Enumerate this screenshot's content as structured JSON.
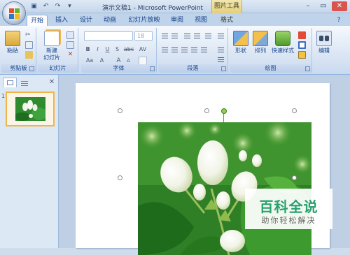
{
  "window": {
    "title": "演示文稿1 - Microsoft PowerPoint",
    "contextual_tools_label": "图片工具",
    "controls": [
      "minimize-icon",
      "maximize-icon",
      "close-icon"
    ]
  },
  "quick_access": [
    "save-icon",
    "undo-icon",
    "redo-icon",
    "customize-icon"
  ],
  "tabs": [
    {
      "label": "开始",
      "active": true
    },
    {
      "label": "插入"
    },
    {
      "label": "设计"
    },
    {
      "label": "动画"
    },
    {
      "label": "幻灯片放映"
    },
    {
      "label": "审阅"
    },
    {
      "label": "视图"
    },
    {
      "label": "格式",
      "contextual": true
    }
  ],
  "ribbon": {
    "clipboard": {
      "label": "剪贴板",
      "paste_label": "粘贴"
    },
    "slides": {
      "label": "幻灯片",
      "new_slide_label_line1": "新建",
      "new_slide_label_line2": "幻灯片"
    },
    "font": {
      "label": "字体",
      "font_name": "",
      "font_size": "18",
      "buttons": [
        "B",
        "I",
        "U",
        "S",
        "abc",
        "AV",
        "Aa",
        "A",
        "A",
        "A"
      ]
    },
    "paragraph": {
      "label": "段落"
    },
    "drawing": {
      "label": "绘图",
      "shapes_label": "形状",
      "arrange_label": "排列",
      "quick_styles_label": "快速样式"
    },
    "editing": {
      "label": "编辑",
      "edit_label": "编辑"
    }
  },
  "left_pane": {
    "slide_number": "1"
  },
  "watermark": {
    "title": "百科全说",
    "subtitle": "助你轻松解决"
  },
  "colors": {
    "accent": "#15428b",
    "ribbon_border": "#8db2e3",
    "watermark_green": "#2aa06e",
    "thumb_border": "#f2b545"
  }
}
